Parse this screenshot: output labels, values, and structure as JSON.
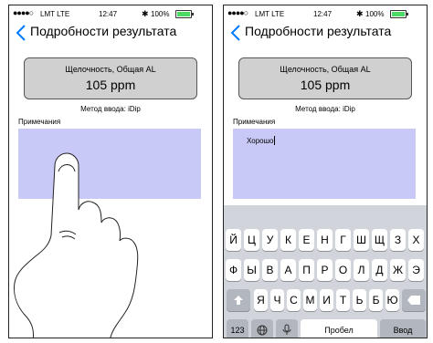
{
  "status_bar": {
    "signal": "●●●●○",
    "carrier": "LMT LTE",
    "time": "12:47",
    "battery": "100%"
  },
  "nav": {
    "title": "Подробности результата"
  },
  "result": {
    "parameter": "Щелочность, Общая AL",
    "value": "105 ppm",
    "input_method": "Метод ввода: iDip"
  },
  "notes": {
    "label": "Примечания",
    "text": "Хорошо"
  },
  "keyboard": {
    "row1": [
      "Й",
      "Ц",
      "У",
      "К",
      "Е",
      "Н",
      "Г",
      "Ш",
      "Щ",
      "З",
      "Х"
    ],
    "row2": [
      "Ф",
      "Ы",
      "В",
      "А",
      "П",
      "Р",
      "О",
      "Л",
      "Д",
      "Ж",
      "Э"
    ],
    "row3": [
      "Я",
      "Ч",
      "С",
      "М",
      "И",
      "Т",
      "Ь",
      "Б",
      "Ю"
    ],
    "numbers_label": "123",
    "space_label": "Пробел",
    "return_label": "Ввод"
  }
}
